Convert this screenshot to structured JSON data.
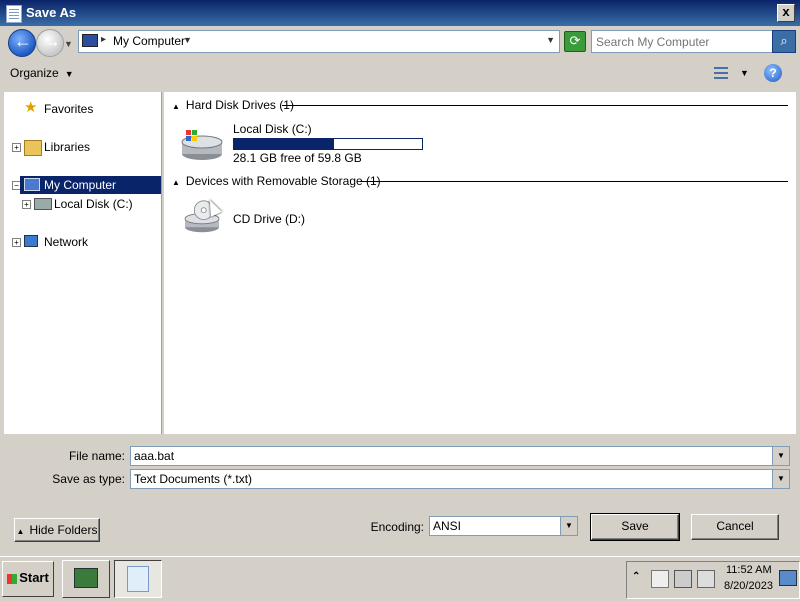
{
  "window": {
    "title": "Save As",
    "close_label": "x"
  },
  "nav": {
    "back_icon": "back-arrow-icon",
    "forward_icon": "forward-arrow-icon",
    "breadcrumb": "My Computer",
    "search_placeholder": "Search My Computer"
  },
  "toolbar": {
    "organize_label": "Organize",
    "help_label": "?"
  },
  "tree": {
    "items": [
      {
        "label": "Favorites",
        "icon": "star-icon"
      },
      {
        "label": "Libraries",
        "icon": "libraries-icon"
      },
      {
        "label": "My Computer",
        "icon": "computer-icon"
      },
      {
        "label": "Local Disk (C:)",
        "icon": "hard-drive-icon"
      },
      {
        "label": "Network",
        "icon": "network-icon"
      }
    ]
  },
  "content": {
    "groups": [
      {
        "header": "Hard Disk Drives (1)"
      },
      {
        "header": "Devices with Removable Storage (1)"
      }
    ],
    "local_disk": {
      "name": "Local Disk (C:)",
      "free_text": "28.1 GB free of 59.8 GB",
      "used_fraction": 0.53
    },
    "cd_drive": {
      "name": "CD Drive (D:)"
    }
  },
  "form": {
    "filename_label": "File name:",
    "filename_value": "aaa.bat",
    "type_label": "Save as type:",
    "type_value": "Text Documents (*.txt)",
    "encoding_label": "Encoding:",
    "encoding_value": "ANSI",
    "save_label": "Save",
    "cancel_label": "Cancel",
    "hide_folders_label": "Hide Folders"
  },
  "taskbar": {
    "start_label": "Start",
    "time": "11:52 AM",
    "date": "8/20/2023"
  },
  "colors": {
    "accent": "#0a246a",
    "face": "#d4d0c8"
  }
}
